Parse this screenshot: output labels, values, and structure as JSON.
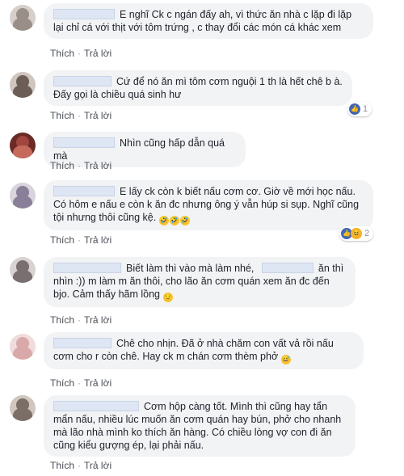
{
  "actions": {
    "like": "Thích",
    "reply": "Trả lời",
    "separator": "·"
  },
  "comments": [
    {
      "text": "E nghĩ Ck c ngán đấy ah, vì thức ăn nhà c lặp đi lặp lại chỉ cá với thịt với tôm trứng , c thay đổi các món cá khác xem",
      "avatar_color": "#9a8f88"
    },
    {
      "text": "Cứ để nó ăn mì tôm cơm nguội 1 th là hết chê b à. Đấy gọi là chiều quá sinh hư",
      "avatar_color": "#6d5d57",
      "reaction": {
        "icons": [
          "like-icon"
        ],
        "count": "1"
      }
    },
    {
      "text": "Nhìn cũng hấp dẫn quá mà",
      "avatar_color": "#a0463e"
    },
    {
      "text": "E lấy ck còn k biết nấu cơm cơ. Giờ về mới học nấu. Có hôm e nấu e còn k ăn đc nhưng ông ý vẫn húp si sụp. Nghĩ cũng tội nhưng thôi cũng kệ.",
      "avatar_color": "#8a7f99",
      "trailing_emoji": [
        "🤣",
        "🤣",
        "🤣"
      ],
      "reaction": {
        "icons": [
          "like-icon",
          "haha-icon"
        ],
        "count": "2"
      }
    },
    {
      "text_parts": [
        "Biết làm thì vào mà làm nhé,",
        "ăn thì nhìn :)) m làm m ăn thôi, cho lão ăn cơm quán xem ăn đc đến bjo. Cảm thấy hãm lồng"
      ],
      "avatar_color": "#7a6f70",
      "trailing_emoji": [
        "😏"
      ]
    },
    {
      "text": "Chê cho nhịn. Đã ở nhà chăm con vất vả rồi nấu cơm cho r còn chê. Hay ck m chán cơm thèm phở",
      "avatar_color": "#d8a9a8",
      "trailing_emoji": [
        "😅"
      ]
    },
    {
      "text": "Cơm hộp càng tốt. Mình thì cũng hay tẩn mẩn nấu, nhiều lúc muốn ăn cơm quán hay bún, phở cho nhanh mà lão nhà mình ko thích ăn hàng. Có chiều lòng vợ con đi ăn cũng kiểu gượng ép, lại phải nấu.",
      "avatar_color": "#7b6e66"
    }
  ]
}
